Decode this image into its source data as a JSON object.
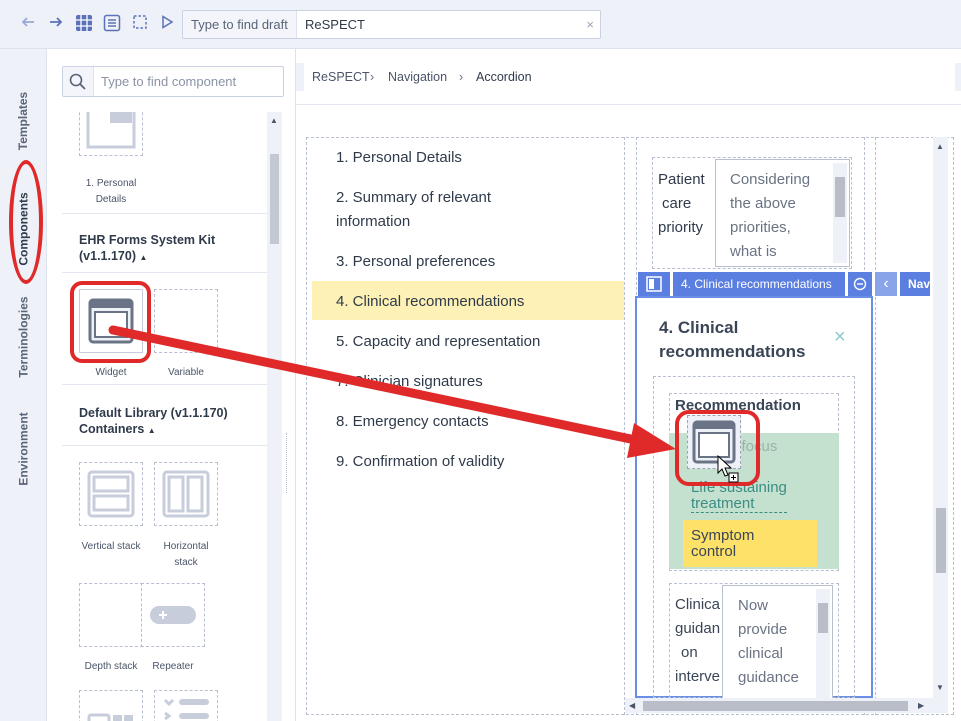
{
  "toolbar": {
    "draft_search_label": "Type to find draft",
    "draft_search_value": "ReSPECT",
    "clear_symbol": "×",
    "icons": [
      "arrow-left-icon",
      "arrow-right-icon",
      "grid-icon",
      "list-icon",
      "select-icon",
      "play-icon"
    ]
  },
  "vtabs": [
    "Templates",
    "Components",
    "Terminologies",
    "Environment"
  ],
  "components": {
    "search_placeholder": "Type to find component",
    "top_item_label_1": "1. Personal",
    "top_item_label_2": "Details",
    "ehr_kit_title_1": "EHR Forms System Kit",
    "ehr_kit_title_2": "(v1.1.170)",
    "ehr_items": [
      "Widget",
      "Variable"
    ],
    "default_lib_title_1": "Default Library (v1.1.170)",
    "default_lib_title_2": "Containers",
    "containers": [
      "Vertical stack",
      "Horizontal",
      "stack",
      "Depth stack",
      "Repeater"
    ]
  },
  "breadcrumb": [
    "ReSPECT",
    "Navigation",
    "Accordion"
  ],
  "nav_items": [
    "1. Personal Details",
    "2. Summary of relevant",
    "information",
    "3. Personal preferences",
    "4. Clinical recommendations",
    "5. Capacity and representation",
    "7. Clinician signatures",
    "8. Emergency contacts",
    "9. Confirmation of validity"
  ],
  "patient_priority": {
    "label": [
      "Patient",
      "care",
      "priority"
    ],
    "textarea": [
      "Considering",
      "the above",
      "priorities,",
      "what is"
    ]
  },
  "card_toolbar": {
    "title": "4. Clinical recommendations",
    "nav_label": "Nav",
    "chevron": "‹"
  },
  "card": {
    "title_1": "4. Clinical",
    "title_2": "recommendations",
    "close": "×",
    "section_label": "Recommendation",
    "option_1": "Clinical focus",
    "option_2a": "Life sustaining",
    "option_2b": "treatment",
    "option_3a": "Symptom",
    "option_3b": "control",
    "guidance_label": [
      "Clinica",
      "guidan",
      "on",
      "interve"
    ],
    "guidance_text": [
      "Now",
      "provide",
      "clinical",
      "guidance"
    ]
  },
  "colors": {
    "accent": "#5b7fe0",
    "highlight": "#fdf1b5",
    "green": "#c4e0cf",
    "yellow": "#fde168",
    "annotation_red": "#e02a2a"
  }
}
